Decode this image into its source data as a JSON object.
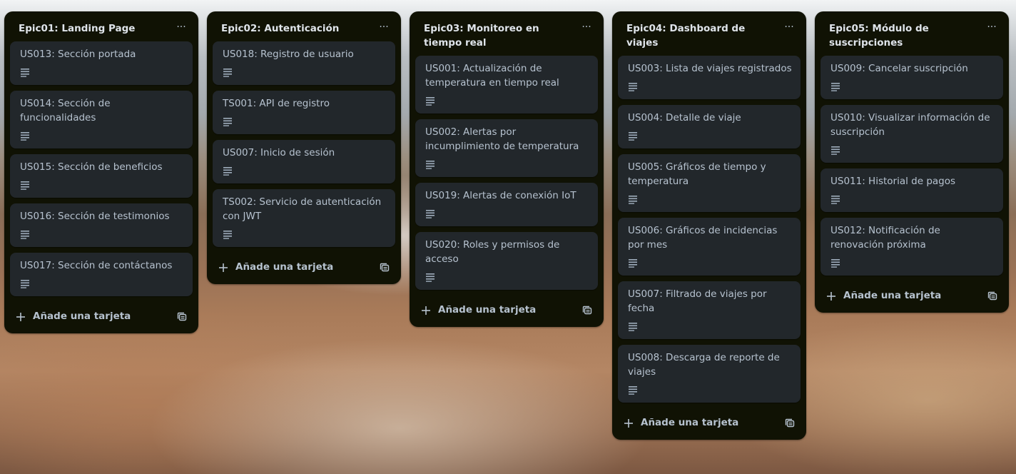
{
  "lists": [
    {
      "title": "Epic01: Landing Page",
      "menu_label": "···",
      "add_card_label": "Añade una tarjeta",
      "cards": [
        {
          "title": "US013: Sección portada"
        },
        {
          "title": "US014: Sección de funcionalidades"
        },
        {
          "title": "US015: Sección de beneficios"
        },
        {
          "title": "US016: Sección de testimonios"
        },
        {
          "title": "US017: Sección de contáctanos"
        }
      ]
    },
    {
      "title": "Epic02: Autenticación",
      "menu_label": "···",
      "add_card_label": "Añade una tarjeta",
      "cards": [
        {
          "title": "US018: Registro de usuario"
        },
        {
          "title": "TS001: API de registro"
        },
        {
          "title": "US007: Inicio de sesión"
        },
        {
          "title": "TS002: Servicio de autenticación con JWT"
        }
      ]
    },
    {
      "title": "Epic03: Monitoreo en tiempo real",
      "menu_label": "···",
      "add_card_label": "Añade una tarjeta",
      "cards": [
        {
          "title": "US001: Actualización de temperatura en tiempo real"
        },
        {
          "title": "US002: Alertas por incumplimiento de temperatura"
        },
        {
          "title": "US019: Alertas de conexión IoT"
        },
        {
          "title": "US020: Roles y permisos de acceso"
        }
      ]
    },
    {
      "title": "Epic04: Dashboard de viajes",
      "menu_label": "···",
      "add_card_label": "Añade una tarjeta",
      "cards": [
        {
          "title": "US003: Lista de viajes registrados"
        },
        {
          "title": "US004: Detalle de viaje"
        },
        {
          "title": "US005: Gráficos de tiempo y temperatura"
        },
        {
          "title": "US006: Gráficos de incidencias por mes"
        },
        {
          "title": "US007: Filtrado de viajes por fecha"
        },
        {
          "title": "US008: Descarga de reporte de viajes"
        }
      ]
    },
    {
      "title": "Epic05: Módulo de suscripciones",
      "menu_label": "···",
      "add_card_label": "Añade una tarjeta",
      "cards": [
        {
          "title": "US009: Cancelar suscripción"
        },
        {
          "title": "US010: Visualizar información de suscripción"
        },
        {
          "title": "US011: Historial de pagos"
        },
        {
          "title": "US012: Notificación de renovación próxima"
        }
      ]
    }
  ],
  "icons": {
    "description": "description-icon",
    "add": "plus-icon",
    "template": "card-template-icon",
    "menu": "ellipsis-icon"
  },
  "colors": {
    "list_bg": "#101204",
    "card_bg": "#22272b",
    "text": "#b6c2cf",
    "title_text": "#dfe4ea"
  }
}
